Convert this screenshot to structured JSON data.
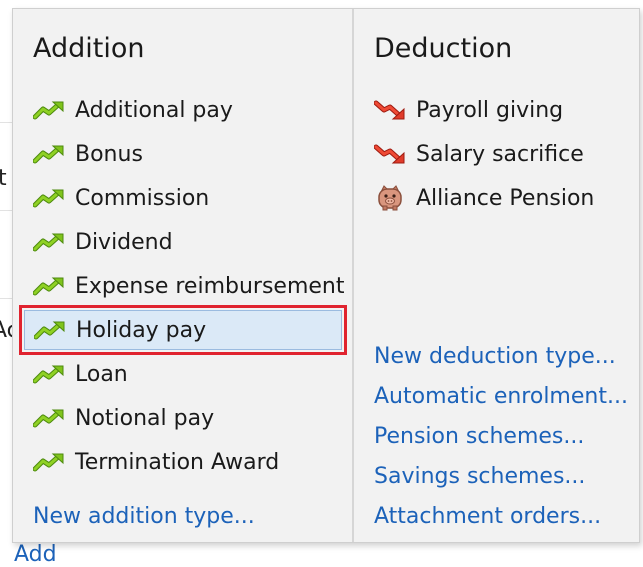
{
  "background": {
    "fragments": [
      "t",
      "Ac",
      "Add"
    ]
  },
  "menu": {
    "addition": {
      "title": "Addition",
      "items": [
        {
          "label": "Additional pay",
          "icon": "green-up-arrow-icon"
        },
        {
          "label": "Bonus",
          "icon": "green-up-arrow-icon"
        },
        {
          "label": "Commission",
          "icon": "green-up-arrow-icon"
        },
        {
          "label": "Dividend",
          "icon": "green-up-arrow-icon"
        },
        {
          "label": "Expense reimbursement",
          "icon": "green-up-arrow-icon"
        },
        {
          "label": "Holiday pay",
          "icon": "green-up-arrow-icon",
          "selected": true
        },
        {
          "label": "Loan",
          "icon": "green-up-arrow-icon"
        },
        {
          "label": "Notional pay",
          "icon": "green-up-arrow-icon"
        },
        {
          "label": "Termination Award",
          "icon": "green-up-arrow-icon"
        }
      ],
      "new_type_link": "New addition type..."
    },
    "deduction": {
      "title": "Deduction",
      "items": [
        {
          "label": "Payroll giving",
          "icon": "red-down-arrow-icon"
        },
        {
          "label": "Salary sacrifice",
          "icon": "red-down-arrow-icon"
        },
        {
          "label": "Alliance Pension",
          "icon": "piggy-bank-icon"
        }
      ],
      "links": [
        "New deduction type...",
        "Automatic enrolment...",
        "Pension schemes...",
        "Savings schemes...",
        "Attachment orders..."
      ]
    }
  },
  "colors": {
    "link": "#1c62b9",
    "selection_fill": "#dbe9f7",
    "highlight_border": "#e0232f",
    "up_arrow": "#7fc31c",
    "down_arrow": "#e03b2a"
  }
}
